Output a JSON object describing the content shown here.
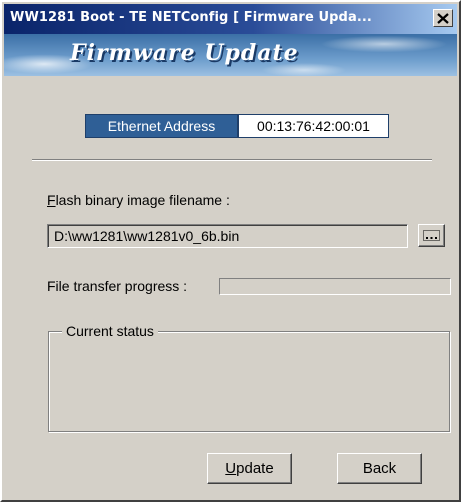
{
  "window": {
    "title": "WW1281 Boot - TE NETConfig [ Firmware Upda...",
    "banner_title": "Firmware Update"
  },
  "ethernet": {
    "label": "Ethernet Address",
    "value": "00:13:76:42:00:01"
  },
  "flash": {
    "label_first_letter": "F",
    "label_rest": "lash binary image filename :",
    "filename": "D:\\ww1281\\ww1281v0_6b.bin",
    "browse_icon": "ellipsis-browse-icon"
  },
  "progress": {
    "label": "File transfer progress :",
    "value_percent": 0
  },
  "status": {
    "group_label": "Current status",
    "text": ""
  },
  "buttons": {
    "update_first_letter": "U",
    "update_rest": "pdate",
    "back_label": "Back"
  },
  "colors": {
    "titlebar_start": "#0a246a",
    "ethernet_label_bg": "#2f5f96",
    "dialog_bg": "#d4d0c8"
  }
}
